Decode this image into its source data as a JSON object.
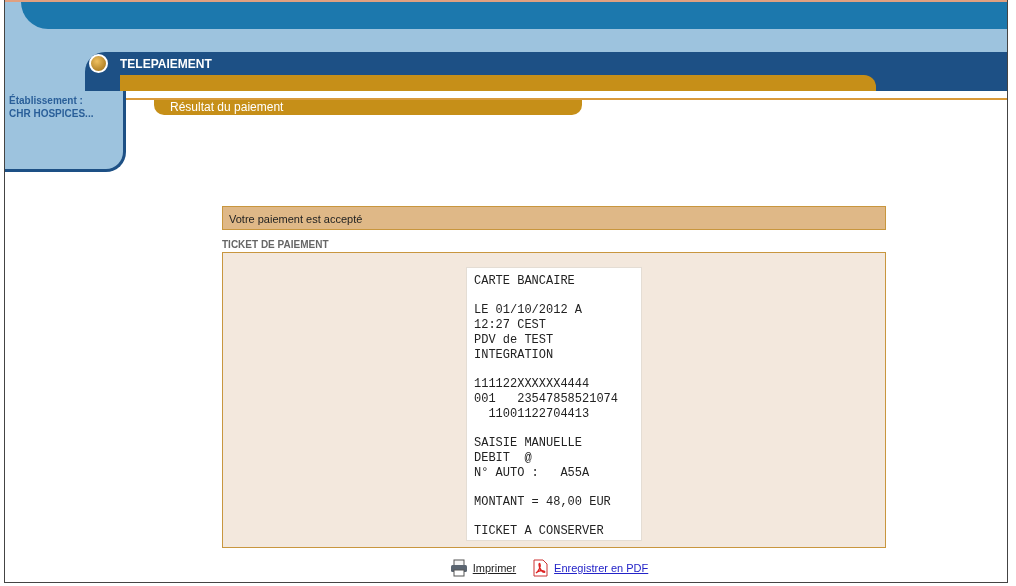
{
  "header": {
    "title": "TELEPAIEMENT",
    "subtitle": "Résultat du paiement",
    "establishment_label": "Établissement :",
    "establishment": "CHR HOSPICES..."
  },
  "status": {
    "message": "Votre paiement est accepté"
  },
  "ticket": {
    "heading": "TICKET DE PAIEMENT",
    "blocks": [
      [
        "CARTE BANCAIRE"
      ],
      [
        "LE 01/10/2012 A",
        "12:27 CEST",
        "PDV de TEST",
        "INTEGRATION"
      ],
      [
        "111122XXXXXX4444",
        "001   23547858521074",
        "  11001122704413"
      ],
      [
        "SAISIE MANUELLE",
        "DEBIT  @",
        "N° AUTO :   A55A"
      ],
      [
        "MONTANT = 48,00 EUR"
      ],
      [
        "TICKET A CONSERVER"
      ]
    ]
  },
  "actions": [
    {
      "kind": "print",
      "label": "Imprimer"
    },
    {
      "kind": "pdf",
      "label": "Enregistrer en PDF"
    }
  ]
}
